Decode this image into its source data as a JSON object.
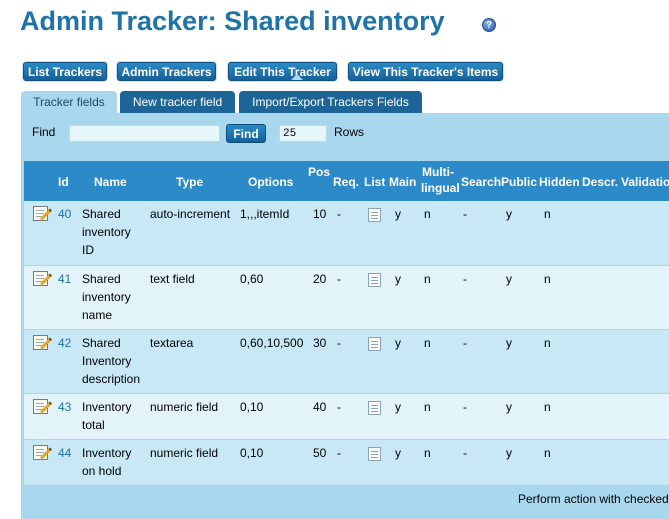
{
  "page": {
    "title": "Admin Tracker: Shared inventory",
    "help_icon_glyph": "?"
  },
  "nav_buttons": [
    {
      "label": "List Trackers"
    },
    {
      "label": "Admin Trackers"
    },
    {
      "label": "Edit This Tracker"
    },
    {
      "label": "View This Tracker's Items"
    }
  ],
  "tabs": [
    {
      "label": "Tracker fields",
      "active": true
    },
    {
      "label": "New tracker field",
      "active": false
    },
    {
      "label": "Import/Export Trackers Fields",
      "active": false
    }
  ],
  "find": {
    "label": "Find",
    "value": "",
    "button_label": "Find",
    "rows_value": "25",
    "rows_label": "Rows"
  },
  "table": {
    "headers": {
      "id": "Id",
      "name": "Name",
      "type": "Type",
      "options": "Options",
      "pos": "Pos",
      "req": "Req.",
      "list": "List",
      "main": "Main",
      "multilingual_1": "Multi-",
      "multilingual_2": "lingual",
      "search": "Search",
      "public": "Public",
      "hidden": "Hidden",
      "descr": "Descr.",
      "validation": "Validation"
    },
    "rows": [
      {
        "id": "40",
        "name_lines": [
          "Shared",
          "inventory",
          "ID"
        ],
        "type": "auto-increment",
        "options": "1,,,itemId",
        "pos": "10",
        "req": "-",
        "main": "y",
        "multilingual": "n",
        "search": "-",
        "public": "y",
        "hidden": "n"
      },
      {
        "id": "41",
        "name_lines": [
          "Shared",
          "inventory",
          "name"
        ],
        "type": "text field",
        "options": "0,60",
        "pos": "20",
        "req": "-",
        "main": "y",
        "multilingual": "n",
        "search": "-",
        "public": "y",
        "hidden": "n"
      },
      {
        "id": "42",
        "name_lines": [
          "Shared",
          "Inventory",
          "description"
        ],
        "type": "textarea",
        "options": "0,60,10,500",
        "pos": "30",
        "req": "-",
        "main": "y",
        "multilingual": "n",
        "search": "-",
        "public": "y",
        "hidden": "n"
      },
      {
        "id": "43",
        "name_lines": [
          "Inventory",
          "total"
        ],
        "type": "numeric field",
        "options": "0,10",
        "pos": "40",
        "req": "-",
        "main": "y",
        "multilingual": "n",
        "search": "-",
        "public": "y",
        "hidden": "n"
      },
      {
        "id": "44",
        "name_lines": [
          "Inventory",
          "on hold"
        ],
        "type": "numeric field",
        "options": "0,10",
        "pos": "50",
        "req": "-",
        "main": "y",
        "multilingual": "n",
        "search": "-",
        "public": "y",
        "hidden": "n"
      }
    ],
    "footer": "Perform action with checked"
  },
  "colors": {
    "title": "#1e73a8",
    "button": "#17609a",
    "panel": "#a9d7ee",
    "header": "#2c8ac9",
    "row_odd": "#c8e8f5",
    "row_even": "#e2f3fa"
  }
}
